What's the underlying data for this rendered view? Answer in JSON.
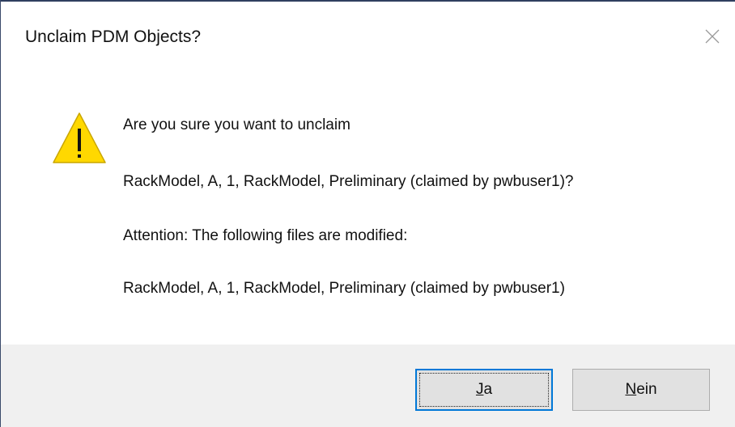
{
  "dialog": {
    "title": "Unclaim PDM Objects?",
    "icon": "warning-icon",
    "messages": {
      "line1": "Are you sure you want to unclaim",
      "line2": "RackModel, A, 1, RackModel, Preliminary (claimed by pwbuser1)?",
      "line3": "Attention: The following files are modified:",
      "line4": "RackModel, A, 1, RackModel, Preliminary (claimed by pwbuser1)"
    },
    "buttons": {
      "yes": {
        "mnemonic": "J",
        "rest": "a"
      },
      "no": {
        "mnemonic": "N",
        "rest": "ein"
      }
    },
    "colors": {
      "warning_fill": "#ffd800",
      "default_button_border": "#0078d7",
      "footer_bg": "#f0f0f0"
    }
  }
}
